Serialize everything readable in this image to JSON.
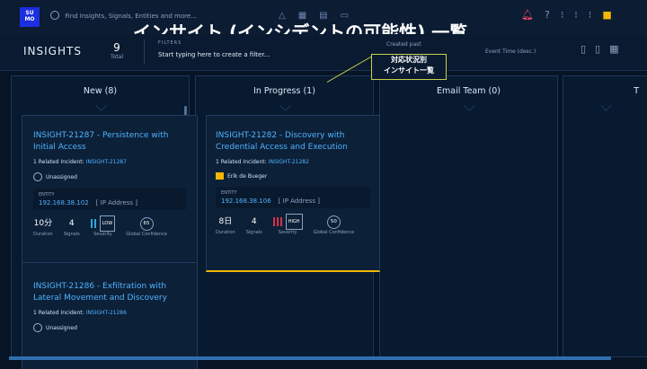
{
  "topbar": {
    "logo": "SU MO",
    "search_placeholder": "Find Insights, Signals, Entities and more..."
  },
  "overlay_title": "インサイト (インシデントの可能性) 一覧",
  "header": {
    "title": "INSIGHTS",
    "total_count": "9",
    "total_label": "Total",
    "filters_label": "FILTERS",
    "filters_placeholder": "Start typing here to create a filter...",
    "created_label": "Created past",
    "sort_label": "Event Time (desc.)"
  },
  "callout": {
    "line1": "対応状況別",
    "line2": "インサイト一覧"
  },
  "columns": [
    {
      "title": "New (8)"
    },
    {
      "title": "In Progress (1)"
    },
    {
      "title": "Email Team (0)"
    },
    {
      "title": "T"
    }
  ],
  "cards": [
    {
      "title": "INSIGHT-21287 - Persistence with Initial Access",
      "rel_label": "1 Related Incident:",
      "rel_id": "INSIGHT-21287",
      "assignee": "Unassigned",
      "entity_label": "ENTITY",
      "ip": "192.168.38.102",
      "ip_type": "[ IP Address ]",
      "duration": "10分",
      "signals": "4",
      "severity": "LOW",
      "confidence": "65",
      "lab_duration": "Duration",
      "lab_signals": "Signals",
      "lab_severity": "Severity",
      "lab_conf": "Global Confidence"
    },
    {
      "title": "INSIGHT-21282 - Discovery with Credential Access and Execution",
      "rel_label": "1 Related Incident:",
      "rel_id": "INSIGHT-21282",
      "assignee": "Erik de Bueger",
      "entity_label": "ENTITY",
      "ip": "192.168.38.106",
      "ip_type": "[ IP Address ]",
      "duration": "8日",
      "signals": "4",
      "severity": "HIGH",
      "confidence": "50",
      "lab_duration": "Duration",
      "lab_signals": "Signals",
      "lab_severity": "Severity",
      "lab_conf": "Global Confidence"
    },
    {
      "title": "INSIGHT-21286 - Exfiltration with Lateral Movement and Discovery",
      "rel_label": "1 Related Incident:",
      "rel_id": "INSIGHT-21286",
      "assignee": "Unassigned"
    }
  ],
  "colors": {
    "accent": "#4fb3ff",
    "low": "#2ea8d8",
    "high": "#d6324a",
    "gold": "#f2b705",
    "pink": "#d0466b"
  }
}
